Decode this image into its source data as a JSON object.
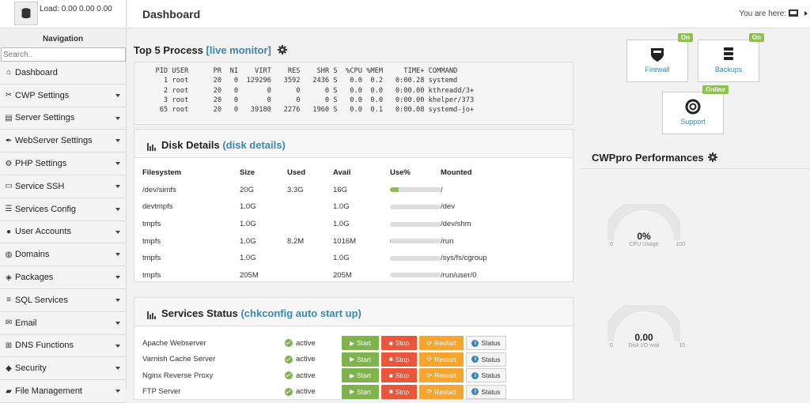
{
  "sidebar": {
    "load_text": "Load: 0.00  0.00  0.00",
    "nav_title": "Navigation",
    "search_placeholder": "Search..",
    "items": [
      {
        "label": "Dashboard",
        "icon": "home-icon",
        "caret": false
      },
      {
        "label": "CWP Settings",
        "icon": "wrench-icon",
        "caret": true
      },
      {
        "label": "Server Settings",
        "icon": "server-icon",
        "caret": true
      },
      {
        "label": "WebServer Settings",
        "icon": "feather-icon",
        "caret": true
      },
      {
        "label": "PHP Settings",
        "icon": "gear-icon",
        "caret": true
      },
      {
        "label": "Service SSH",
        "icon": "monitor-icon",
        "caret": true
      },
      {
        "label": "Services Config",
        "icon": "list-icon",
        "caret": true
      },
      {
        "label": "User Accounts",
        "icon": "user-icon",
        "caret": true
      },
      {
        "label": "Domains",
        "icon": "globe-icon",
        "caret": true
      },
      {
        "label": "Packages",
        "icon": "cubes-icon",
        "caret": true
      },
      {
        "label": "SQL Services",
        "icon": "database-icon",
        "caret": true
      },
      {
        "label": "Email",
        "icon": "envelope-icon",
        "caret": true
      },
      {
        "label": "DNS Functions",
        "icon": "sitemap-icon",
        "caret": true
      },
      {
        "label": "Security",
        "icon": "shield-icon",
        "caret": true
      },
      {
        "label": "File Management",
        "icon": "folder-icon",
        "caret": true
      }
    ]
  },
  "header": {
    "title": "Dashboard",
    "breadcrumb_label": "You are here:"
  },
  "top5": {
    "title": "Top 5 Process",
    "link": "[live monitor]",
    "lines": [
      "  PID USER      PR  NI    VIRT    RES    SHR S  %CPU %MEM     TIME+ COMMAND",
      "    1 root      20   0  129296   3592   2436 S   0.0  0.2   0:00.28 systemd",
      "    2 root      20   0       0      0      0 S   0.0  0.0   0:00.00 kthreadd/3+",
      "    3 root      20   0       0      0      0 S   0.0  0.0   0:00.00 khelper/373",
      "   65 root      20   0   39180   2276   1960 S   0.0  0.1   0:00.08 systemd-jo+"
    ]
  },
  "disk": {
    "title": "Disk Details",
    "link": "(disk details)",
    "headers": [
      "Filesystem",
      "Size",
      "Used",
      "Avail",
      "Use%",
      "Mounted"
    ],
    "rows": [
      {
        "fs": "/dev/simfs",
        "size": "20G",
        "used": "3.3G",
        "avail": "16G",
        "pct": 0.17,
        "mount": "/"
      },
      {
        "fs": "devtmpfs",
        "size": "1.0G",
        "used": "",
        "avail": "1.0G",
        "pct": 0,
        "mount": "/dev"
      },
      {
        "fs": "tmpfs",
        "size": "1.0G",
        "used": "",
        "avail": "1.0G",
        "pct": 0,
        "mount": "/dev/shm"
      },
      {
        "fs": "tmpfs",
        "size": "1.0G",
        "used": "8.2M",
        "avail": "1016M",
        "pct": 0.01,
        "mount": "/run"
      },
      {
        "fs": "tmpfs",
        "size": "1.0G",
        "used": "",
        "avail": "1.0G",
        "pct": 0,
        "mount": "/sys/fs/cgroup"
      },
      {
        "fs": "tmpfs",
        "size": "205M",
        "used": "",
        "avail": "205M",
        "pct": 0,
        "mount": "/run/user/0"
      }
    ]
  },
  "services": {
    "title": "Services Status",
    "link": "(chkconfig auto start up)",
    "buttons": {
      "start": "Start",
      "stop": "Stop",
      "restart": "Restart",
      "status": "Status"
    },
    "rows": [
      {
        "name": "Apache Webserver",
        "state": "active"
      },
      {
        "name": "Varnish Cache Server",
        "state": "active"
      },
      {
        "name": "Nginx Reverse Proxy",
        "state": "active"
      },
      {
        "name": "FTP Server",
        "state": "active"
      }
    ]
  },
  "tiles": [
    {
      "label": "Firewall",
      "badge": "On",
      "icon": "shield-icon"
    },
    {
      "label": "Backups",
      "badge": "On",
      "icon": "database-icon"
    },
    {
      "label": "Support",
      "badge": "Online",
      "icon": "lifebuoy-icon"
    }
  ],
  "performance": {
    "title": "CWPpro Performances",
    "gauges": [
      {
        "value": "0%",
        "caption": "CPU Usage",
        "min": "0",
        "max": "100",
        "level": 0
      },
      {
        "value": "0.00",
        "caption": "Disk I/O wait",
        "min": "0",
        "max": "15",
        "level": 0
      }
    ]
  },
  "colors": {
    "accent": "#3a87ad",
    "green": "#8cc152",
    "red": "#e9563b",
    "orange": "#f6a531"
  }
}
